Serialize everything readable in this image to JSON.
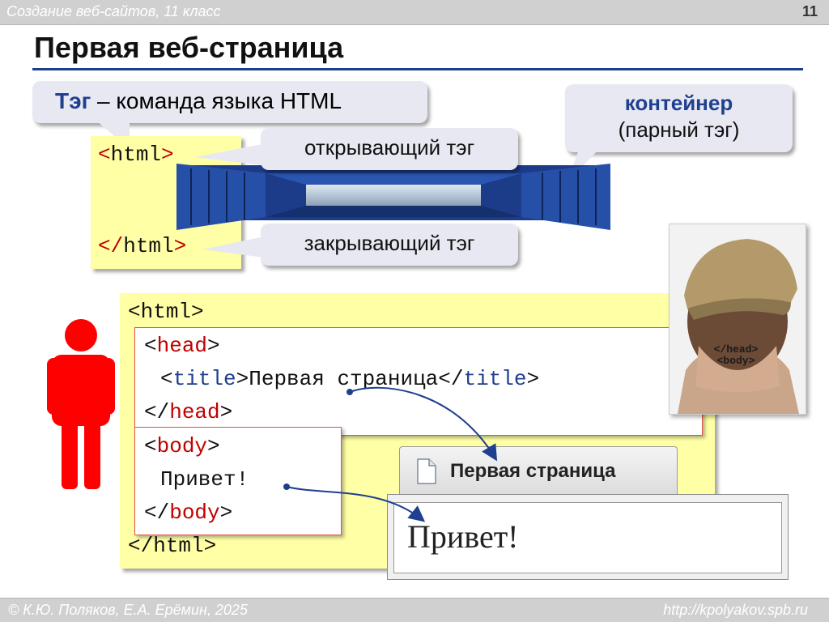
{
  "header": {
    "course": "Создание веб-сайтов, 11 класс",
    "page_number": "11"
  },
  "title": "Первая веб-страница",
  "tag_callout": {
    "term": "Тэг",
    "definition": " – команда языка HTML"
  },
  "container_callout": {
    "term": "контейнер",
    "note": "(парный тэг)"
  },
  "opening_tag_callout": "открывающий тэг",
  "closing_tag_callout": "закрывающий тэг",
  "small_code": {
    "open": "html",
    "close": "html"
  },
  "code": {
    "html": "html",
    "head": "head",
    "title": "title",
    "title_text": "Первая страница",
    "body": "body",
    "body_text": "Привет!"
  },
  "browser": {
    "tab_title": "Первая страница",
    "content": "Привет!"
  },
  "neck_tattoo": {
    "line1": "</head>",
    "line2": "<body>"
  },
  "footer": {
    "author": "© К.Ю. Поляков, Е.А. Ерёмин, 2025",
    "url": "http://kpolyakov.spb.ru"
  },
  "colors": {
    "accent": "#1f3f8f",
    "tag_red": "#c00000",
    "code_bg": "#ffffa6",
    "figure_red": "#ff0000"
  }
}
